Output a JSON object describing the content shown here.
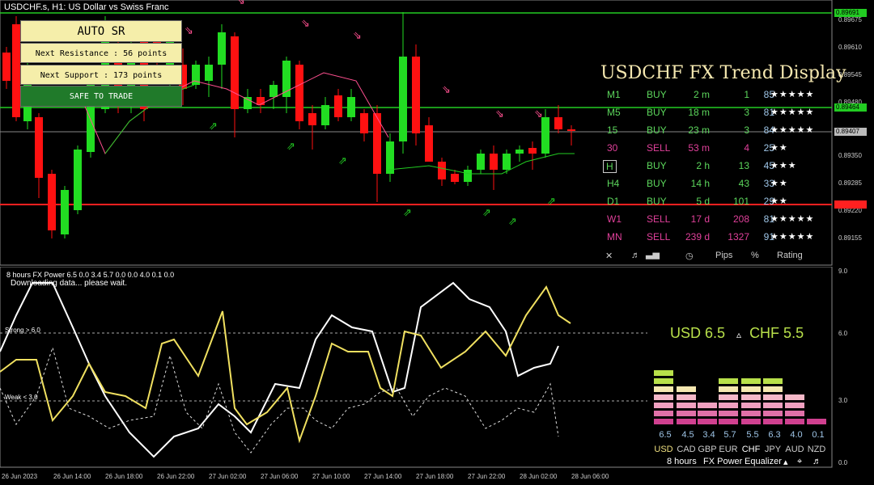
{
  "chart_title": "USDCHF.s, H1:  US Dollar vs Swiss Franc",
  "price_axis": [
    "0.89675",
    "0.89610",
    "0.89545",
    "0.89480",
    "0.89350",
    "0.89285",
    "0.89220",
    "0.89155"
  ],
  "price_tags": {
    "top": "0.89691",
    "mid": "0.89464",
    "cur": "0.89407",
    "red": "0.89233"
  },
  "auto_sr": {
    "title": "AUTO SR",
    "resistance": "Next Resistance : 56 points",
    "support": "Next Support : 173 points",
    "status": "SAFE TO TRADE"
  },
  "trend_display": {
    "title": "USDCHF FX Trend Display",
    "rows": [
      {
        "tf": "M1",
        "signal": "BUY",
        "dur": "2 m",
        "pips": "1",
        "pct": "85",
        "stars": "★★★★★",
        "color": "green"
      },
      {
        "tf": "M5",
        "signal": "BUY",
        "dur": "18 m",
        "pips": "3",
        "pct": "81",
        "stars": "★★★★★",
        "color": "green"
      },
      {
        "tf": "15",
        "signal": "BUY",
        "dur": "23 m",
        "pips": "3",
        "pct": "84",
        "stars": "★★★★★",
        "color": "green"
      },
      {
        "tf": "30",
        "signal": "SELL",
        "dur": "53 m",
        "pips": "4",
        "pct": "25",
        "stars": "★★",
        "color": "pink"
      },
      {
        "tf": "H",
        "signal": "BUY",
        "dur": "2 h",
        "pips": "13",
        "pct": "45",
        "stars": "★★★",
        "color": "green"
      },
      {
        "tf": "H4",
        "signal": "BUY",
        "dur": "14 h",
        "pips": "43",
        "pct": "33",
        "stars": "★★",
        "color": "green"
      },
      {
        "tf": "D1",
        "signal": "BUY",
        "dur": "5 d",
        "pips": "101",
        "pct": "29",
        "stars": "★★",
        "color": "green"
      },
      {
        "tf": "W1",
        "signal": "SELL",
        "dur": "17 d",
        "pips": "208",
        "pct": "81",
        "stars": "★★★★★",
        "color": "pink"
      },
      {
        "tf": "MN",
        "signal": "SELL",
        "dur": "239 d",
        "pips": "1327",
        "pct": "91",
        "stars": "★★★★★",
        "color": "pink"
      }
    ],
    "footer": {
      "close": "✕",
      "sound": "♬",
      "pips": "Pips",
      "pct": "%",
      "rating": "Rating"
    }
  },
  "power": {
    "subtitle": "8 hours FX Power 6.5 0.0 3.4 5.7 0.0 0.0 4.0 0.1 0.0",
    "loading": "Downloading data... please wait.",
    "strong_label": "Strong > 6.0",
    "weak_label": "Weak < 3.0",
    "usd_text": "USD 6.5",
    "delta": "▵",
    "chf_text": "CHF 5.5",
    "axis": [
      "9.0",
      "6.0",
      "3.0",
      "0.0"
    ]
  },
  "equalizer": {
    "values": [
      "6.5",
      "4.5",
      "3.4",
      "5.7",
      "5.5",
      "6.3",
      "4.0",
      "0.1"
    ],
    "currencies": [
      "USD",
      "CAD",
      "GBP",
      "EUR",
      "CHF",
      "JPY",
      "AUD",
      "NZD"
    ],
    "levels": [
      6.5,
      4.5,
      3.4,
      5.7,
      5.5,
      6.3,
      4.0,
      0.1
    ],
    "footer_hours": "8 hours",
    "footer_name": "FX Power",
    "footer_eq": "Equalizer"
  },
  "time_axis": [
    "26 Jun 2023",
    "26 Jun 14:00",
    "26 Jun 18:00",
    "26 Jun 22:00",
    "27 Jun 02:00",
    "27 Jun 06:00",
    "27 Jun 10:00",
    "27 Jun 14:00",
    "27 Jun 18:00",
    "27 Jun 22:00",
    "28 Jun 02:00",
    "28 Jun 06:00"
  ],
  "colors": {
    "bull": "#22dd22",
    "bear": "#ff1111",
    "resist": "#22cc22",
    "support": "#ff2020",
    "gold": "#f5e8b0"
  }
}
